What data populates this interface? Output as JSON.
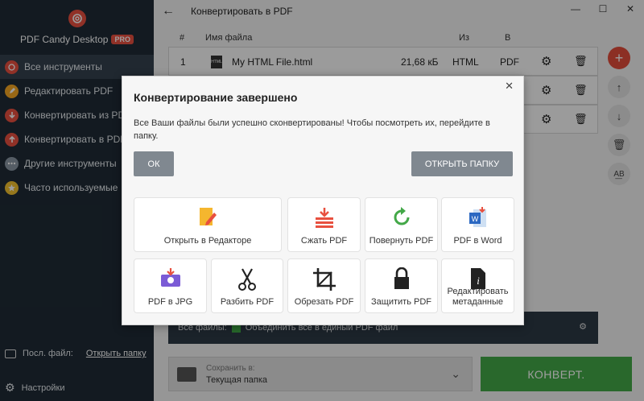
{
  "sidebar": {
    "app_name": "PDF Candy Desktop",
    "pro_badge": "PRO",
    "items": [
      {
        "label": "Все инструменты"
      },
      {
        "label": "Редактировать PDF"
      },
      {
        "label": "Конвертировать из PDF"
      },
      {
        "label": "Конвертировать в PDF"
      },
      {
        "label": "Другие инструменты"
      },
      {
        "label": "Часто используемые"
      }
    ],
    "last_file_label": "Посл. файл:",
    "open_folder_link": "Открыть папку",
    "settings_label": "Настройки"
  },
  "titlebar": {
    "title": "Конвертировать в PDF"
  },
  "table": {
    "headers": {
      "num": "#",
      "name": "Имя файла",
      "from": "Из",
      "to": "В"
    },
    "rows": [
      {
        "num": "1",
        "name": "My HTML File.html",
        "size": "21,68 кБ",
        "from": "HTML",
        "to": "PDF",
        "icon_text": "HTML"
      }
    ]
  },
  "bottom": {
    "all_files": "Все файлы:",
    "merge_label": "Объединить все в единый PDF файл"
  },
  "save": {
    "label": "Сохранить в:",
    "value": "Текущая папка"
  },
  "convert_label": "КОНВЕРТ.",
  "dialog": {
    "title": "Конвертирование завершено",
    "message": "Все Ваши файлы были успешно сконвертированы! Чтобы посмотреть их, перейдите в папку.",
    "ok": "ОК",
    "open_folder": "ОТКРЫТЬ ПАПКУ",
    "tiles": [
      {
        "label": "Открыть в Редакторе"
      },
      {
        "label": "Сжать PDF"
      },
      {
        "label": "Повернуть PDF"
      },
      {
        "label": "PDF в Word"
      },
      {
        "label": "PDF в JPG"
      },
      {
        "label": "Разбить PDF"
      },
      {
        "label": "Обрезать PDF"
      },
      {
        "label": "Защитить PDF"
      },
      {
        "label": "Редактировать метаданные"
      }
    ]
  },
  "colors": {
    "accent_red": "#e24c3a",
    "green": "#43a848",
    "sidebar": "#1f2b36"
  }
}
